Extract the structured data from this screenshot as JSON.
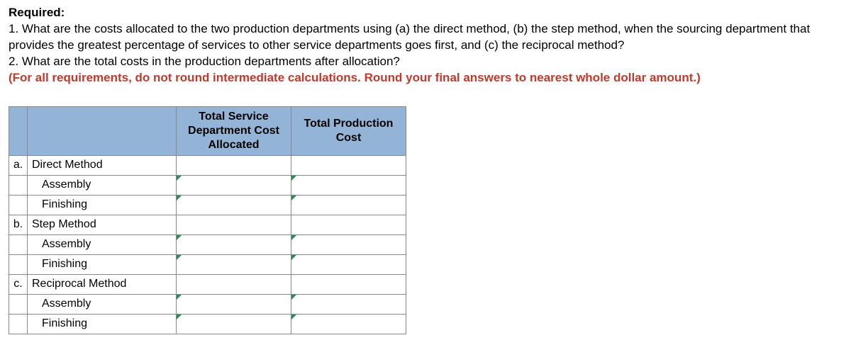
{
  "required": {
    "heading": "Required:",
    "line1": "1. What are the costs allocated to the two production departments using (a) the direct method, (b) the step method, when the sourcing department that provides the greatest percentage of services to other service departments goes first, and (c) the reciprocal method?",
    "line2": "2. What are the total costs in the production departments after allocation?",
    "note": "(For all requirements, do not round intermediate calculations. Round your final answers to nearest whole dollar amount.)"
  },
  "table": {
    "headers": {
      "service": "Total Service Department Cost Allocated",
      "production": "Total Production Cost"
    },
    "rows": [
      {
        "letter": "a.",
        "label": "Direct Method",
        "indent": false,
        "inputs": false
      },
      {
        "letter": "",
        "label": "Assembly",
        "indent": true,
        "inputs": true
      },
      {
        "letter": "",
        "label": "Finishing",
        "indent": true,
        "inputs": true
      },
      {
        "letter": "b.",
        "label": "Step Method",
        "indent": false,
        "inputs": false
      },
      {
        "letter": "",
        "label": "Assembly",
        "indent": true,
        "inputs": true
      },
      {
        "letter": "",
        "label": "Finishing",
        "indent": true,
        "inputs": true
      },
      {
        "letter": "c.",
        "label": "Reciprocal Method",
        "indent": false,
        "inputs": false
      },
      {
        "letter": "",
        "label": "Assembly",
        "indent": true,
        "inputs": true
      },
      {
        "letter": "",
        "label": "Finishing",
        "indent": true,
        "inputs": true
      }
    ]
  }
}
